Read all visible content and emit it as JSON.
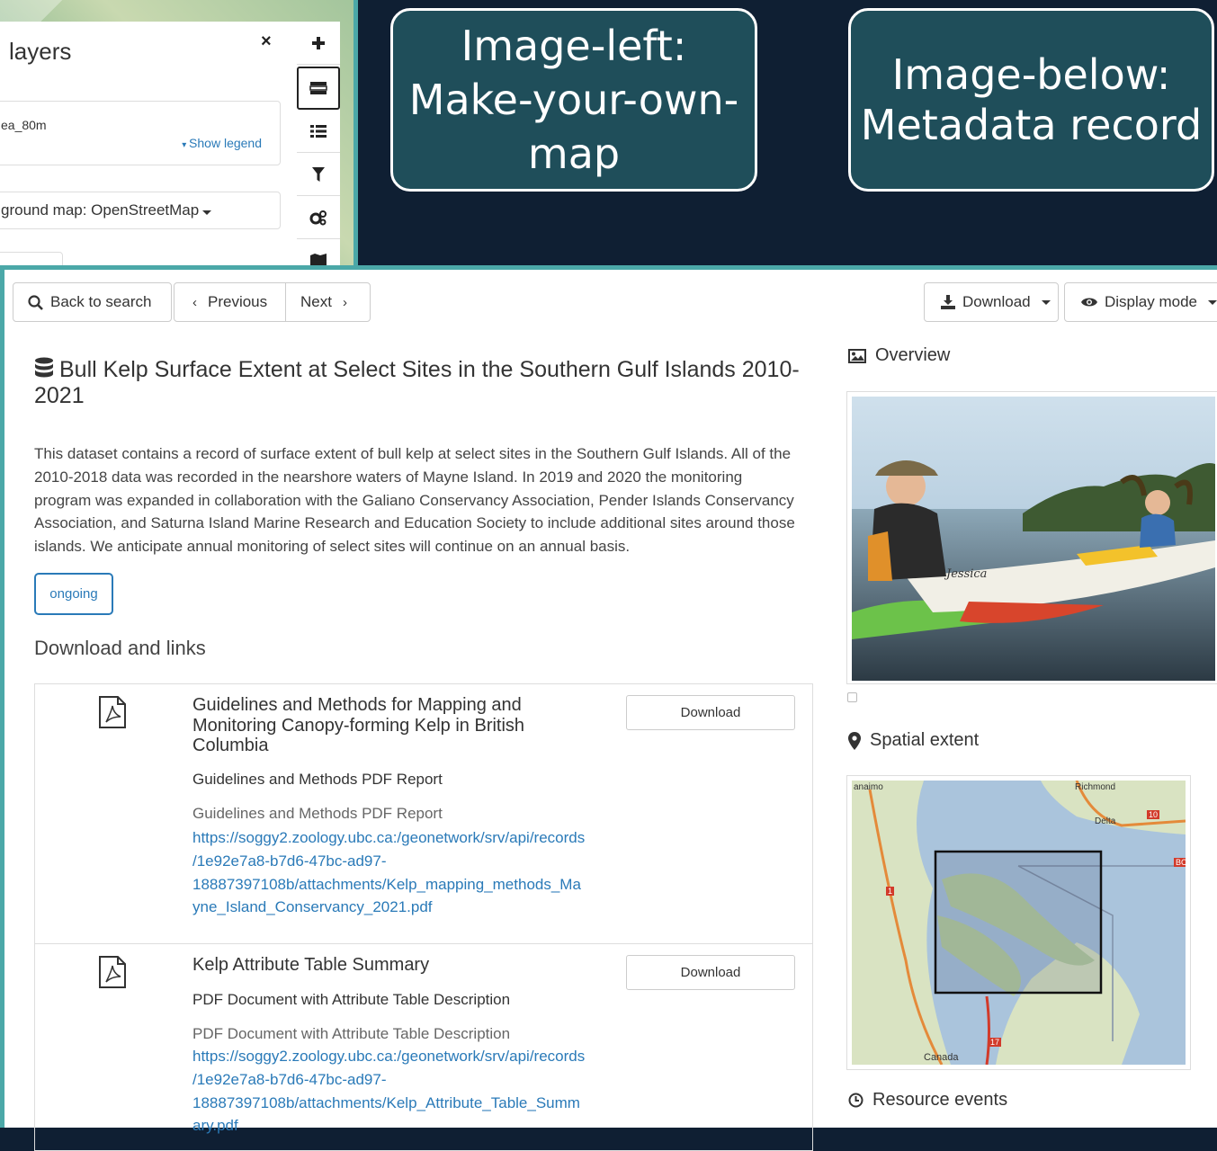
{
  "callouts": {
    "left": [
      "Image-left:",
      "Make-your-own-",
      "map"
    ],
    "right": [
      "Image-below:",
      "Metadata record"
    ]
  },
  "map_panel": {
    "title": "layers",
    "close": "×",
    "layer_name": "ea_80m",
    "show_legend": "Show legend",
    "background_map": "ground map: OpenStreetMap",
    "toolbar_icons": [
      "plus-icon",
      "layers-icon",
      "list-icon",
      "filter-icon",
      "gears-icon",
      "map-icon"
    ]
  },
  "toolbar": {
    "back": "Back to search",
    "previous": "Previous",
    "next": "Next",
    "download": "Download",
    "display_mode": "Display mode"
  },
  "record": {
    "title": "Bull Kelp Surface Extent at Select Sites in the Southern Gulf Islands 2010-2021",
    "abstract_lines": [
      "This dataset contains a record of surface extent of bull kelp at select sites in the Southern Gulf Islands. All of the",
      "2010-2018 data was recorded in the nearshore waters of Mayne Island. In 2019 and 2020 the monitoring",
      "program was expanded in collaboration with the Galiano Conservancy Association, Pender Islands Conservancy",
      "Association, and Saturna Island Marine Research and Education Society to include additional sites around those",
      "islands. We anticipate annual monitoring of select sites will continue on an annual basis."
    ],
    "status": "ongoing"
  },
  "links": {
    "heading": "Download and links",
    "items": [
      {
        "title_lines": [
          "Guidelines and Methods for Mapping and",
          "Monitoring Canopy-forming Kelp in British",
          "Columbia"
        ],
        "desc": "Guidelines and Methods PDF Report",
        "desc2": "Guidelines and Methods PDF Report",
        "url_lines": [
          "https://soggy2.zoology.ubc.ca:/geonetwork/srv/api/records",
          "/1e92e7a8-b7d6-47bc-ad97-",
          "18887397108b/attachments/Kelp_mapping_methods_Ma",
          "yne_Island_Conservancy_2021.pdf"
        ],
        "button": "Download"
      },
      {
        "title_lines": [
          "Kelp Attribute Table Summary"
        ],
        "desc": "PDF Document with Attribute Table Description",
        "desc2": "PDF Document with Attribute Table Description",
        "url_lines": [
          "https://soggy2.zoology.ubc.ca:/geonetwork/srv/api/records",
          "/1e92e7a8-b7d6-47bc-ad97-",
          "18887397108b/attachments/Kelp_Attribute_Table_Summ",
          "ary.pdf"
        ],
        "button": "Download"
      }
    ]
  },
  "side": {
    "overview": "Overview",
    "photo_caption": "Jessica",
    "spatial_extent": "Spatial extent",
    "map_labels": {
      "nanaimo": "anaimo",
      "richmond": "Richmond",
      "delta": "Delta",
      "canada": "Canada",
      "r1": "1",
      "r10": "10",
      "r17": "17",
      "bc": "BC"
    },
    "resource_events": "Resource events"
  }
}
